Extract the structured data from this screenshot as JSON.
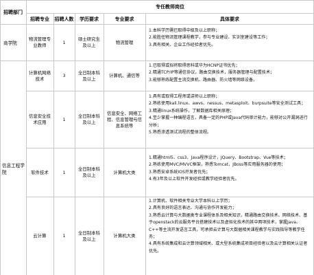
{
  "table": {
    "header_top": {
      "dept": "招聘部门",
      "group": "专任教师岗位"
    },
    "header_cols": {
      "major": "招聘专业",
      "count": "招聘人数",
      "edu": "学历要求",
      "spec": "专业要求",
      "detail": "具体要求"
    },
    "rows": [
      {
        "dept": "商学院",
        "major": "物流管理专业教师",
        "count": "1",
        "edu": "硕士研究生及以上",
        "spec": "物流管理",
        "reqs": [
          "1.本科学历需已取得中级及以上职称；",
          "2.能胜任物流管理课程教学，参与专业建设、实训室建设等工作；",
          "3.具有相关、企业工作经验者优先。"
        ]
      },
      {
        "dept": "信息工程学院",
        "major": "计算机网络技术",
        "count": "3",
        "edu": "全日制本科及以上",
        "spec": "计算机、通信等",
        "reqs": [
          "1.已取得或拟将取得思科或华为HCNP证书优先；",
          "2.精通TCP/IP等通信协议，路由交换技术，服务器管理与配置技术；",
          "3.能够熟练配置主流交换机、路由器、防火墙等网络设备。"
        ]
      },
      {
        "major": "信息安全技术应用",
        "count": "1",
        "edu": "全日制本科及以上",
        "spec": "信息安全、网络工程、信息管理与信息系统等",
        "reqs": [
          "1.具有或取得工程师或讲师以上职称；",
          "2.熟练使用kali.linux、awvs、nessus、metasploit、burpsuite等安全测试工具；",
          "3.精通linux系统操作，了解数据库相关原理；",
          "4.至少掌握一种编程语言，具备一定的PHP或Java代码审计能力，能够对公开漏洞进行分析；",
          "5.熟悉渗透测试流程的整体流程。"
        ]
      },
      {
        "major": "软件技术",
        "count": "1",
        "edu": "全日制本科及以上",
        "spec": "计算机大类",
        "reqs": [
          "1.精通html5、css3、Java程序设计，JQuery、Bootstrap、Vue等技术；",
          "2.熟练使用MVC/MVVC框架，熟悉Tomcat、JBoss等应用服务器的使用；",
          "3.熟悉安卓系统IOS开发者优先；",
          "4.有3年及以上软件开发经验或教学经验者优先。"
        ]
      },
      {
        "major": "云计算",
        "count": "1",
        "edu": "全日制本科及以上",
        "spec": "计算机大类",
        "reqs": [
          "1.计算机、软件相关专业大学本科以上学历；",
          "2.具有良好的语言表达、沟通与协作开发能力；",
          "3.熟悉云计算与大数据类专业课程体系及相关知识，精通路由交换技术、网络技术、基于openstack的云服务平台搭建技术以及虚拟化技术的其中两项技术，掌握Java、C++等主流开发语言工具，可承担云计算与大数据相关课程教学与实践指导等教学任务；",
          "4.具有系统集成和云计算领域相关、或大型系统集成项目经验者以及云计算相关认证者优先。"
        ]
      }
    ]
  }
}
